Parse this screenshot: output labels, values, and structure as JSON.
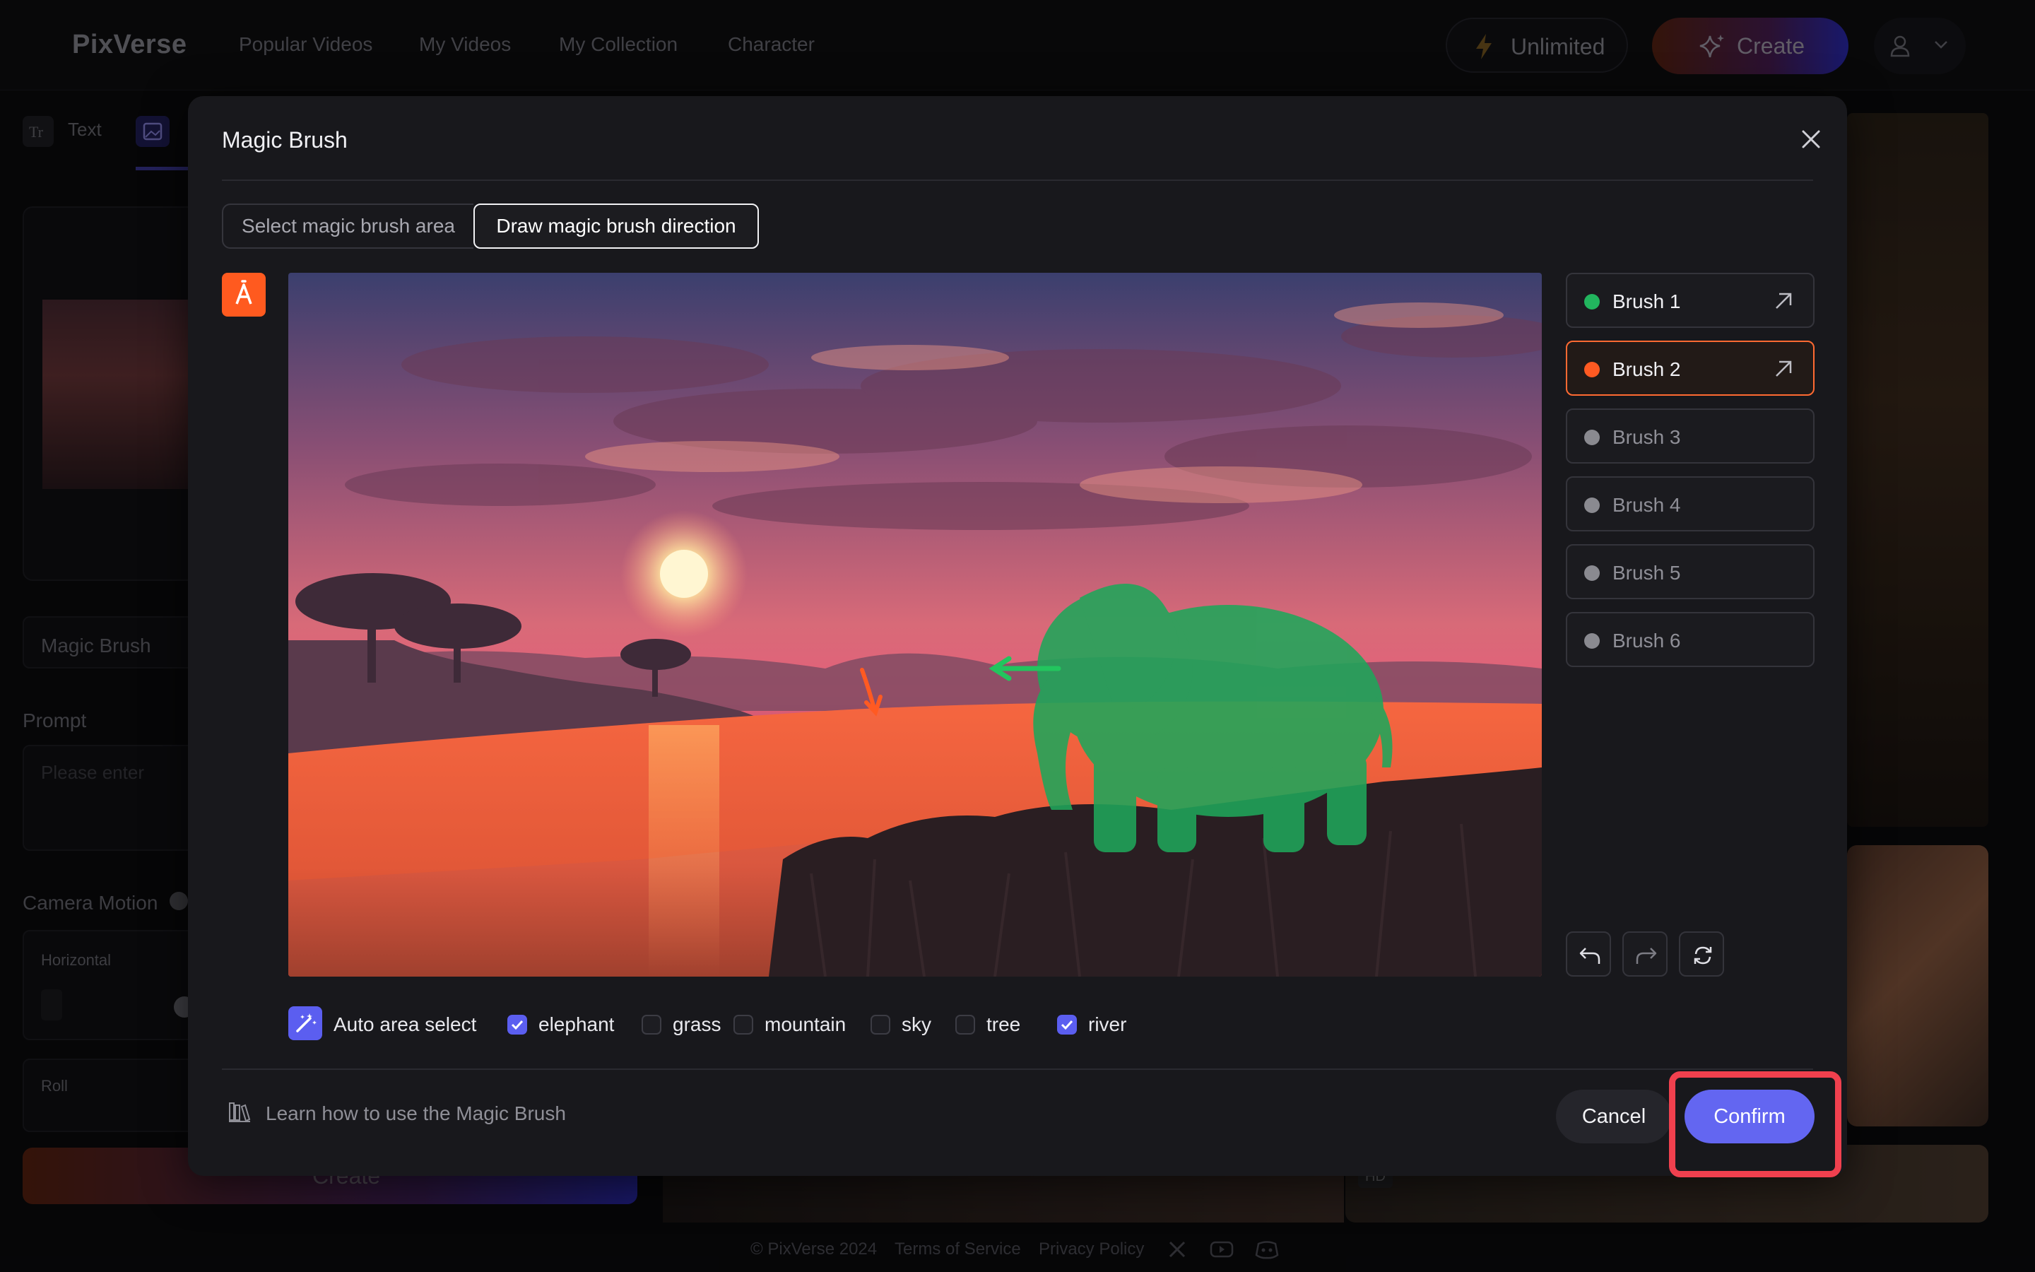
{
  "nav": {
    "logo": "PixVerse",
    "links": [
      "Popular Videos",
      "My Videos",
      "My Collection",
      "Character"
    ],
    "unlimited": "Unlimited",
    "create": "Create"
  },
  "bg": {
    "tab_text": "Text",
    "field_value": "Magic Brush",
    "prompt_label": "Prompt",
    "prompt_placeholder": "Please enter",
    "camera_label": "Camera Motion",
    "horizontal_label": "Horizontal",
    "roll_label": "Roll",
    "create": "Create",
    "hd_badge": "HD"
  },
  "footer": {
    "copyright": "© PixVerse 2024",
    "terms": "Terms of Service",
    "privacy": "Privacy Policy"
  },
  "modal": {
    "title": "Magic Brush",
    "seg_select": "Select magic brush area",
    "seg_draw": "Draw magic brush direction",
    "brushes": [
      {
        "label": "Brush 1",
        "color": "#22b55e",
        "active": false,
        "has_arrow": true
      },
      {
        "label": "Brush 2",
        "color": "#ff5a22",
        "active": true,
        "has_arrow": true
      },
      {
        "label": "Brush 3",
        "color": "#8a8a90",
        "active": false,
        "has_arrow": false
      },
      {
        "label": "Brush 4",
        "color": "#8a8a90",
        "active": false,
        "has_arrow": false
      },
      {
        "label": "Brush 5",
        "color": "#8a8a90",
        "active": false,
        "has_arrow": false
      },
      {
        "label": "Brush 6",
        "color": "#8a8a90",
        "active": false,
        "has_arrow": false
      }
    ],
    "auto_area_select": "Auto area select",
    "areas": [
      {
        "label": "elephant",
        "checked": true
      },
      {
        "label": "grass",
        "checked": false
      },
      {
        "label": "mountain",
        "checked": false
      },
      {
        "label": "sky",
        "checked": false
      },
      {
        "label": "tree",
        "checked": false
      },
      {
        "label": "river",
        "checked": true
      }
    ],
    "learn": "Learn how to use the Magic Brush",
    "cancel": "Cancel",
    "confirm": "Confirm"
  },
  "colors": {
    "accent": "#6366f1",
    "brush_orange": "#ff5a1f",
    "brush_green": "#22b55e",
    "highlight": "#f0404e"
  }
}
